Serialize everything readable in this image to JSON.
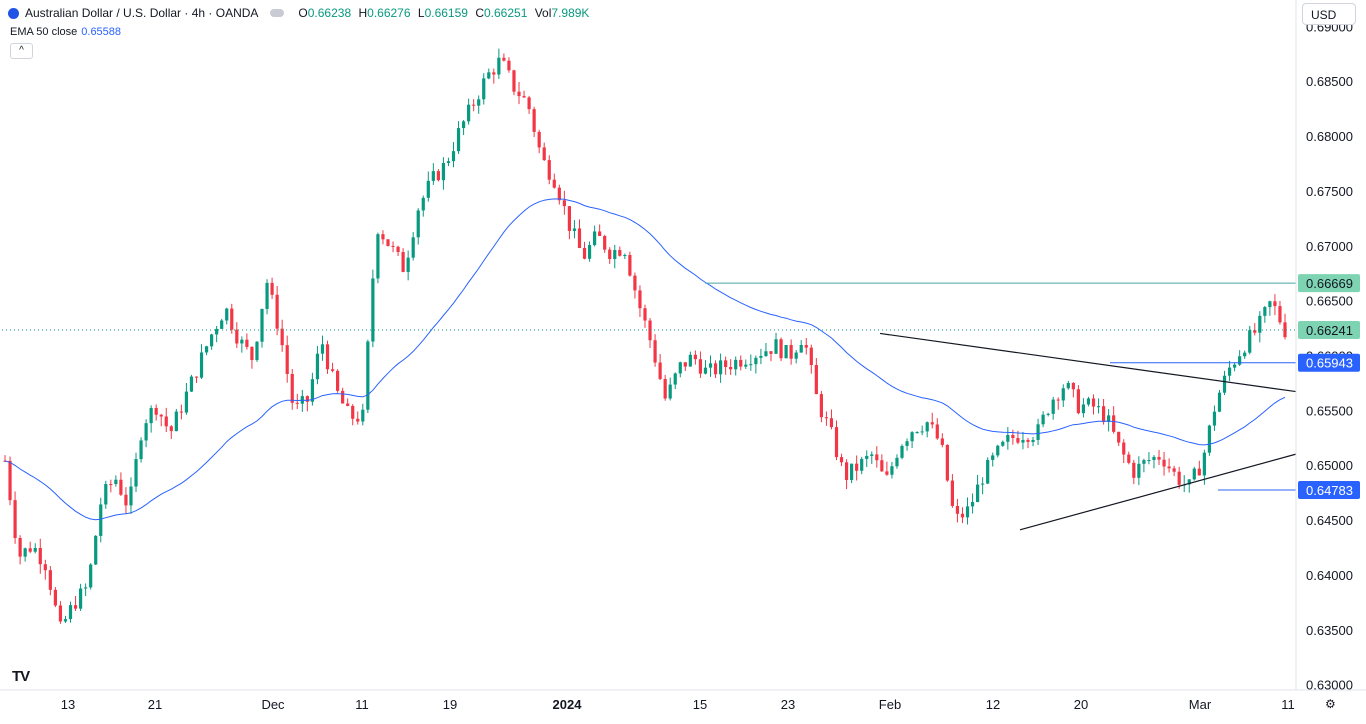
{
  "header": {
    "symbol": "Australian Dollar / U.S. Dollar · 4h · OANDA",
    "open_label": "O",
    "open": "0.66238",
    "high_label": "H",
    "high": "0.66276",
    "low_label": "L",
    "low": "0.66159",
    "close_label": "C",
    "close": "0.66251",
    "vol_label": "Vol",
    "vol": "7.989K",
    "ema_label": "EMA 50 close",
    "ema_value": "0.65588",
    "collapse_icon": "^"
  },
  "currency_select": "USD",
  "logo_text": "TV",
  "settings_icon": "⚙",
  "colors": {
    "up": "#089981",
    "down": "#f23645",
    "ema": "#2962ff",
    "line": "#131722",
    "label_green": "#7ed3b2",
    "label_blue": "#2962ff"
  },
  "chart_data": {
    "type": "candlestick",
    "y_range": [
      0.6296,
      0.6914
    ],
    "y_ticks": [
      "0.69000",
      "0.68500",
      "0.68000",
      "0.67500",
      "0.67000",
      "0.66500",
      "0.66000",
      "0.65500",
      "0.65000",
      "0.64500",
      "0.64000",
      "0.63500",
      "0.63000"
    ],
    "x_ticks": [
      "13",
      "21",
      "Dec",
      "11",
      "19",
      "2024",
      "15",
      "23",
      "Feb",
      "12",
      "20",
      "Mar",
      "11"
    ],
    "price_labels": [
      {
        "text": "0.66669",
        "value": 0.66669,
        "style": "green"
      },
      {
        "text": "0.66241",
        "value": 0.66241,
        "style": "green"
      },
      {
        "text": "0.65943",
        "value": 0.65943,
        "style": "blue"
      },
      {
        "text": "0.64783",
        "value": 0.64783,
        "style": "blue"
      }
    ],
    "horizontal_lines": [
      0.66669,
      0.65943,
      0.64783
    ],
    "current_price": 0.66241,
    "trendlines": [
      {
        "from": [
          0.6621,
          "Jan 31"
        ],
        "to": [
          0.6568,
          "Mar 12"
        ]
      },
      {
        "from": [
          0.6442,
          "Feb 13"
        ],
        "to": [
          0.6511,
          "Mar 12"
        ]
      }
    ],
    "price_path": [
      0.6505,
      0.6418,
      0.6428,
      0.641,
      0.635,
      0.6375,
      0.639,
      0.647,
      0.649,
      0.6462,
      0.654,
      0.6555,
      0.653,
      0.656,
      0.659,
      0.662,
      0.6645,
      0.6615,
      0.6598,
      0.667,
      0.662,
      0.655,
      0.656,
      0.6615,
      0.657,
      0.6545,
      0.6545,
      0.672,
      0.67,
      0.668,
      0.6735,
      0.676,
      0.6775,
      0.6805,
      0.683,
      0.6855,
      0.687,
      0.6845,
      0.683,
      0.678,
      0.676,
      0.672,
      0.669,
      0.671,
      0.6695,
      0.67,
      0.665,
      0.661,
      0.656,
      0.659,
      0.66,
      0.6585,
      0.659,
      0.6595,
      0.66,
      0.6605,
      0.661,
      0.66,
      0.662,
      0.656,
      0.653,
      0.649,
      0.65,
      0.651,
      0.6485,
      0.652,
      0.6535,
      0.654,
      0.652,
      0.645,
      0.646,
      0.649,
      0.651,
      0.6525,
      0.653,
      0.653,
      0.656,
      0.6575,
      0.6555,
      0.6555,
      0.6545,
      0.6515,
      0.6495,
      0.6505,
      0.651,
      0.6492,
      0.648,
      0.6505,
      0.656,
      0.659,
      0.661,
      0.6625,
      0.665,
      0.6624
    ]
  }
}
